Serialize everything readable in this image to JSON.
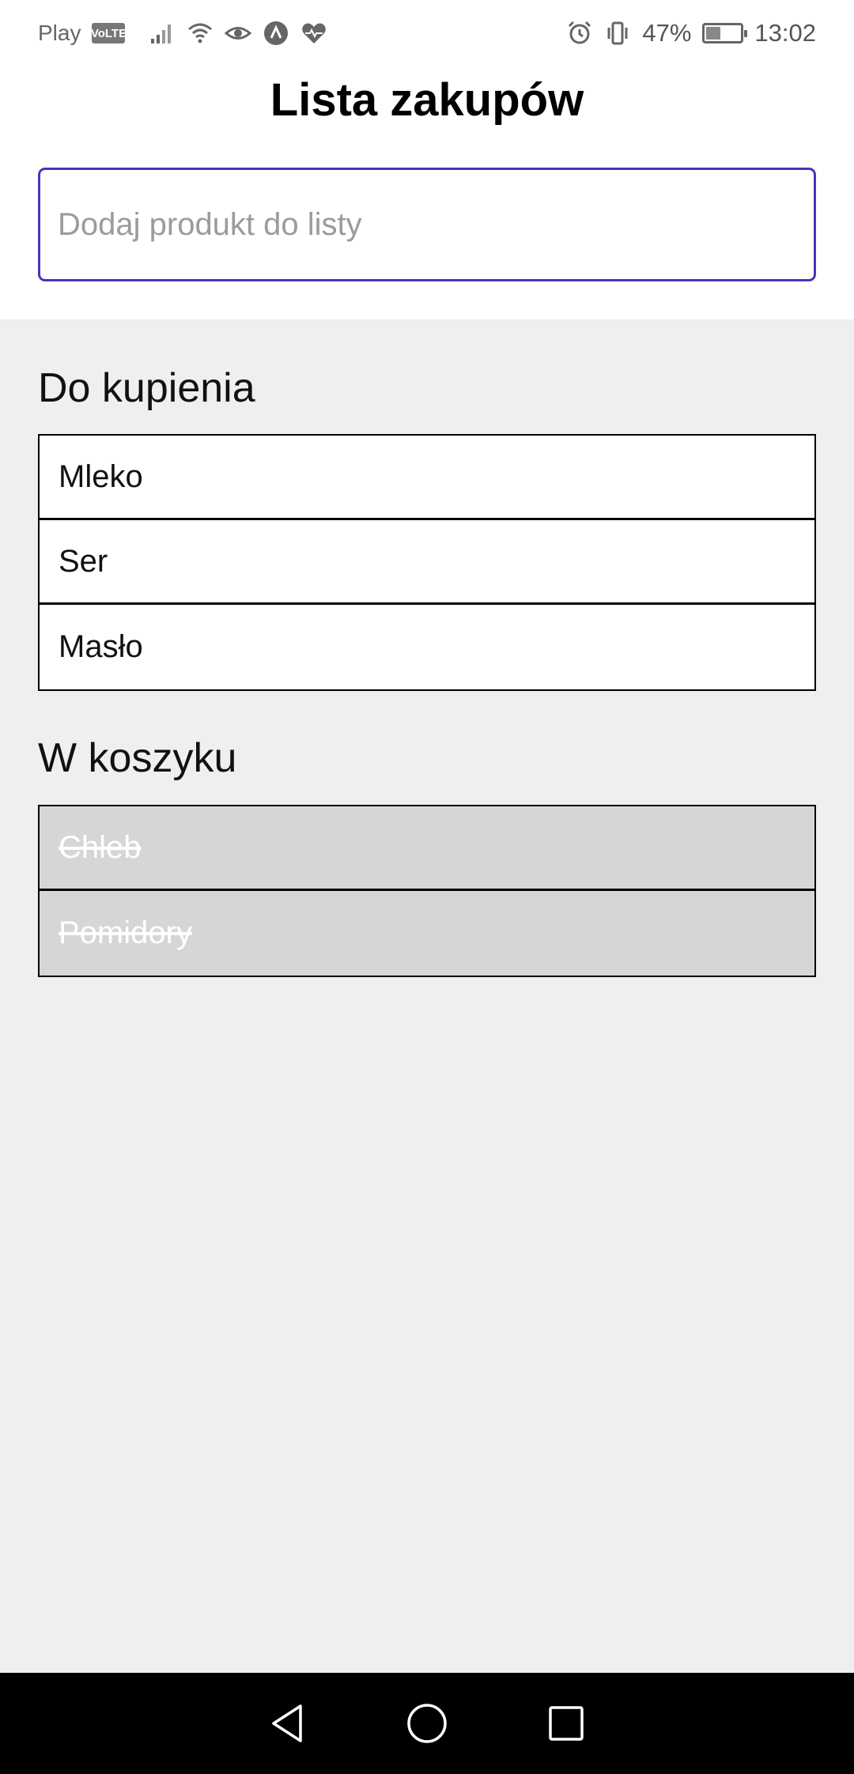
{
  "status_bar": {
    "carrier": "Play",
    "volte": "VoLTE",
    "battery_percent": "47%",
    "battery_level": 0.47,
    "time": "13:02",
    "icons": [
      "signal-icon",
      "wifi-icon",
      "eye-icon",
      "app-logo-icon",
      "heart-rate-icon",
      "alarm-icon",
      "vibrate-icon",
      "battery-icon"
    ]
  },
  "app": {
    "title": "Lista zakupów",
    "input": {
      "placeholder": "Dodaj produkt do listy",
      "value": ""
    },
    "accent_color": "#4d32b8"
  },
  "to_buy": {
    "title": "Do kupienia",
    "items": [
      "Mleko",
      "Ser",
      "Masło"
    ]
  },
  "in_cart": {
    "title": "W koszyku",
    "items": [
      "Chleb",
      "Pomidory"
    ]
  },
  "nav_bar": {
    "icons": [
      "back-icon",
      "home-icon",
      "recents-icon"
    ]
  }
}
